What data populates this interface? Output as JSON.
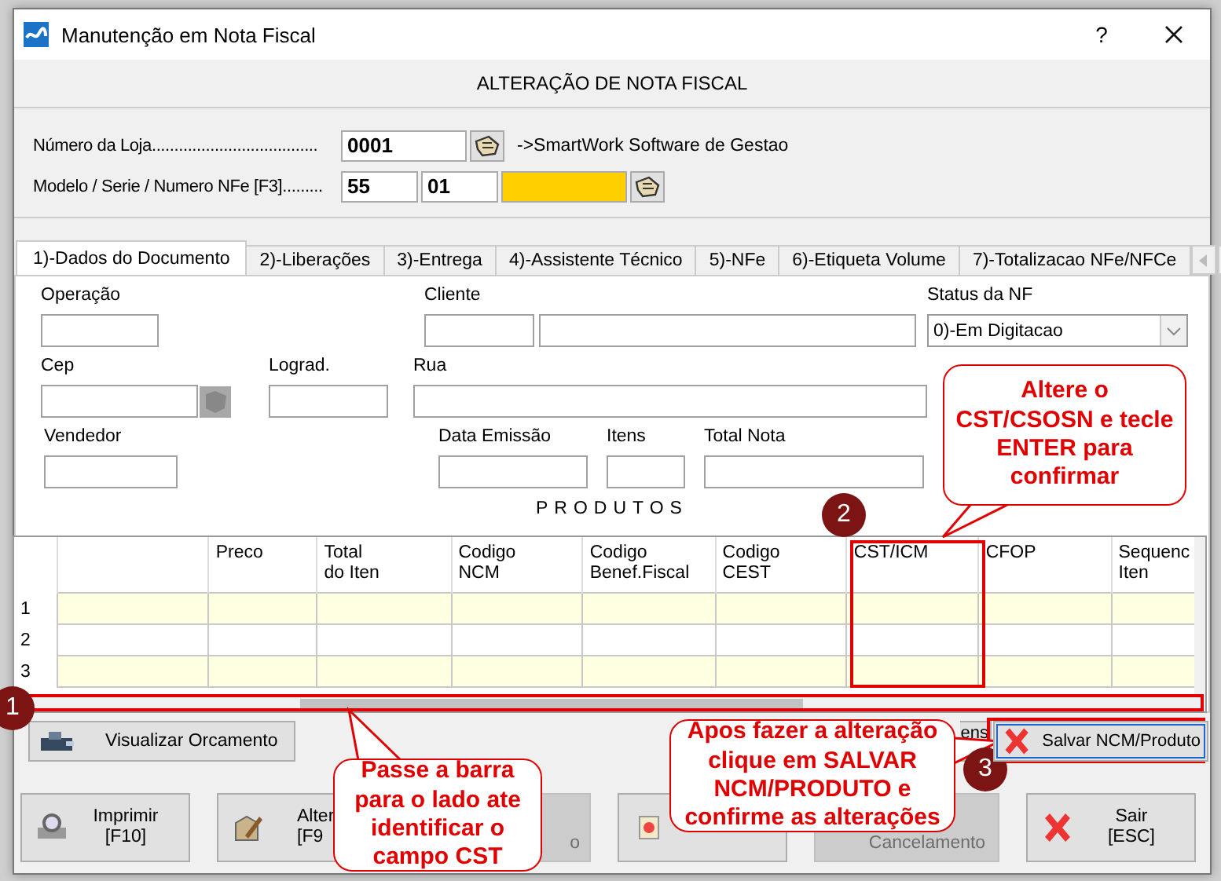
{
  "window": {
    "title": "Manutenção em Nota Fiscal",
    "help": "?"
  },
  "header": "ALTERAÇÃO DE NOTA FISCAL",
  "store": {
    "label": "Número da Loja.....................................",
    "value": "0001",
    "description": "->SmartWork Software de Gestao"
  },
  "document": {
    "label": "Modelo / Serie / Numero NFe [F3].........",
    "model": "55",
    "series": "01",
    "number_focused": true
  },
  "tabs": [
    {
      "label": "1)-Dados do Documento",
      "selected": true
    },
    {
      "label": "2)-Liberações",
      "selected": false
    },
    {
      "label": "3)-Entrega",
      "selected": false
    },
    {
      "label": "4)-Assistente Técnico",
      "selected": false
    },
    {
      "label": "5)-NFe",
      "selected": false
    },
    {
      "label": "6)-Etiqueta Volume",
      "selected": false
    },
    {
      "label": "7)-Totalizacao NFe/NFCe",
      "selected": false
    }
  ],
  "fields": [
    {
      "label": "Operação"
    },
    {
      "label": "Cliente"
    },
    {
      "label": "Status da NF",
      "value": "0)-Em Digitacao"
    },
    {
      "label": "Cep"
    },
    {
      "label": "Lograd."
    },
    {
      "label": "Rua"
    },
    {
      "label": "Vendedor"
    },
    {
      "label": "Data Emissão"
    },
    {
      "label": "Itens"
    },
    {
      "label": "Total Nota"
    }
  ],
  "products": {
    "title": "PRODUTOS",
    "columns": [
      "Preco",
      "Total\ndo Iten",
      "Codigo\nNCM",
      "Codigo\nBenef.Fiscal",
      "Codigo\nCEST",
      "CST/ICM",
      "CFOP",
      "Sequenc\nIten"
    ],
    "rows": [
      {
        "number": "1",
        "highlighted": true
      },
      {
        "number": "2",
        "highlighted": false
      },
      {
        "number": "3",
        "highlighted": true
      }
    ]
  },
  "actions": [
    {
      "kind": "view",
      "label": "Visualizar Orcamento"
    },
    {
      "kind": "plain",
      "label": "ens"
    },
    {
      "kind": "save",
      "label": "Salvar NCM/Produto"
    }
  ],
  "bottom_buttons": [
    {
      "kind": "print",
      "lines": [
        "Imprimir",
        "[F10]"
      ],
      "disabled": false
    },
    {
      "kind": "edit",
      "lines": [
        "Alter",
        "[F9"
      ],
      "disabled": false
    },
    {
      "kind": "blank",
      "lines": [
        "o"
      ],
      "disabled": true
    },
    {
      "kind": "doc",
      "disabled": false
    },
    {
      "kind": "blank",
      "lines": [
        "Cancelamento"
      ],
      "disabled": true
    },
    {
      "kind": "exit",
      "lines": [
        "Sair",
        "[ESC]"
      ],
      "disabled": false
    }
  ],
  "annotations": [
    {
      "number": "1",
      "text": "Passe a barra para o lado ate identificar o campo CST"
    },
    {
      "number": "2",
      "text": "Altere o CST/CSOSN e tecle ENTER para confirmar"
    },
    {
      "number": "3",
      "text": "Apos fazer a alteração clique em SALVAR NCM/PRODUTO e confirme as alterações"
    }
  ]
}
